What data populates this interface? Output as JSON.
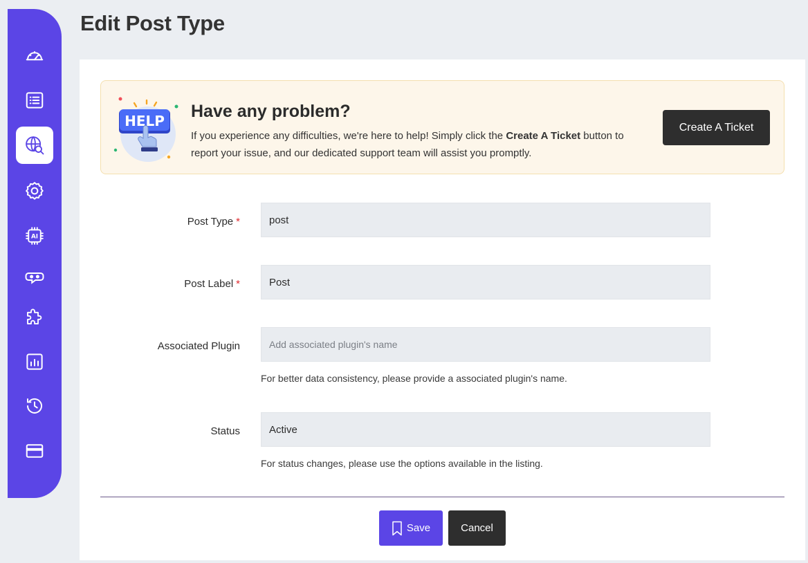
{
  "page": {
    "title": "Edit Post Type"
  },
  "sidebar": {
    "items": [
      {
        "icon": "dashboard-gauge-icon"
      },
      {
        "icon": "list-icon"
      },
      {
        "icon": "globe-search-icon",
        "active": true
      },
      {
        "icon": "gear-icon"
      },
      {
        "icon": "ai-chip-icon"
      },
      {
        "icon": "bot-icon"
      },
      {
        "icon": "puzzle-icon"
      },
      {
        "icon": "bar-chart-icon"
      },
      {
        "icon": "history-icon"
      },
      {
        "icon": "card-icon"
      }
    ],
    "colors": {
      "background": "#5b45e6",
      "icon": "#ffffff",
      "active_icon": "#5b45e6"
    }
  },
  "help": {
    "badge_text": "HELP",
    "title": "Have any problem?",
    "text_before": "If you experience any difficulties, we're here to help! Simply click the ",
    "text_bold": "Create A Ticket",
    "text_after": " button to report your issue, and our dedicated support team will assist you promptly.",
    "button_label": "Create A Ticket"
  },
  "form": {
    "post_type": {
      "label": "Post Type",
      "required_mark": "*",
      "value": "post"
    },
    "post_label": {
      "label": "Post Label",
      "required_mark": "*",
      "value": "Post"
    },
    "associated_plugin": {
      "label": "Associated Plugin",
      "value": "",
      "placeholder": "Add associated plugin's name",
      "hint": "For better data consistency, please provide a associated plugin's name."
    },
    "status": {
      "label": "Status",
      "value": "Active",
      "hint": "For status changes, please use the options available in the listing."
    }
  },
  "actions": {
    "save_label": "Save",
    "cancel_label": "Cancel"
  },
  "colors": {
    "accent": "#5b45e6",
    "dark_button": "#2e2e2e",
    "banner_bg": "#fdf6ea",
    "required": "#e0292f"
  }
}
